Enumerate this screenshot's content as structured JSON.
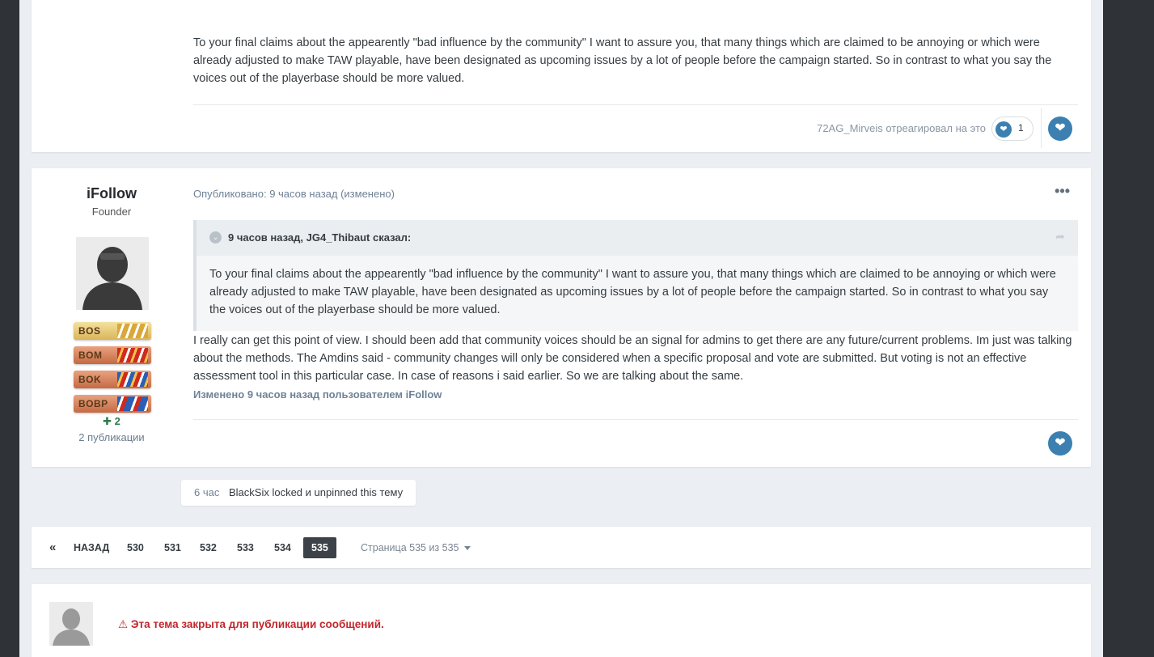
{
  "post1": {
    "body": "To your final claims about the appearently \"bad influence by the community\" I want to assure you, that many things which are claimed to be annoying or which were already adjusted to make TAW playable, have been designated as upcoming issues by a lot of people before the campaign started. So in contrast to what you say the voices out of the playerbase should be more valued.",
    "reacted_by": "72AG_Mirveis отреагировал на это",
    "reaction_count": "1"
  },
  "post2": {
    "author": {
      "name": "iFollow",
      "title": "Founder",
      "badges": [
        "BOS",
        "BOM",
        "BOK",
        "BOBP"
      ],
      "reputation": "2",
      "posts": "2 публикации"
    },
    "posted": "Опубликовано: 9 часов назад (изменено)",
    "quote": {
      "citation": "9 часов назад, JG4_Thibaut сказал:",
      "text": "To your final claims about the appearently \"bad influence by the community\" I want to assure you, that many things which are claimed to be annoying or which were already adjusted to make TAW playable, have been designated as upcoming issues by a lot of people before the campaign started. So in contrast to what you say the voices out of the playerbase should be more valued."
    },
    "body": "I really can get this point of view. I should been add that community voices should be an signal for admins to get there are any future/current problems. Im just was talking about the methods. The Amdins said - community changes will only be considered when a specific proposal and vote are submitted. But voting is not an effective assessment tool in this particular case. In case of reasons i said earlier. So we are talking about the same.",
    "edited": "Изменено 9 часов назад пользователем iFollow"
  },
  "event": {
    "time": "6 час",
    "text": "BlackSix locked и unpinned this тему"
  },
  "pagination": {
    "first": "«",
    "prev": "НАЗАД",
    "pages": [
      "530",
      "531",
      "532",
      "533",
      "534",
      "535"
    ],
    "current": "535",
    "page_of": "Страница 535 из 535"
  },
  "locked_notice": "Эта тема закрыта для публикации сообщений.",
  "colors": {
    "accent": "#3b80b1",
    "locked": "#c1272d",
    "reputation": "#2f7a4c"
  }
}
